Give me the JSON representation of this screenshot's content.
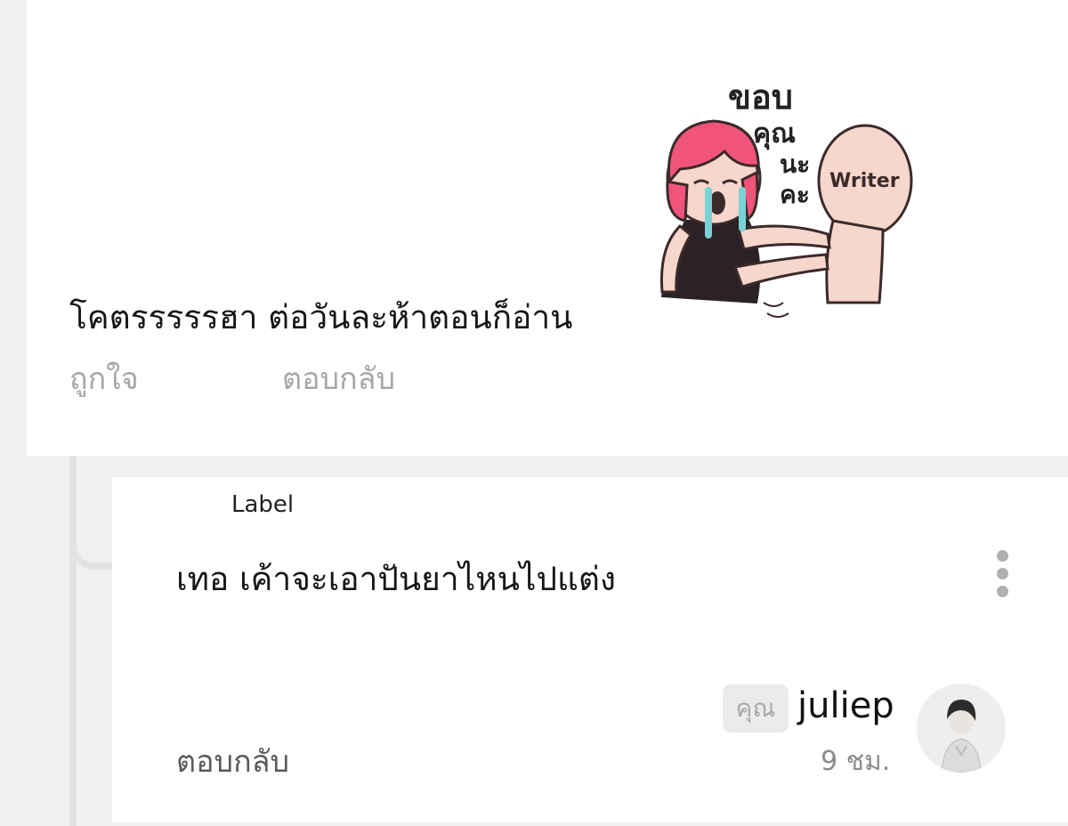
{
  "top_comment": {
    "sticker": {
      "caption": "ขอบ คุณ นะ คะ",
      "tag_text": "Writer"
    },
    "text": "โคตรรรรรฮา ต่อวันละห้าตอนก็อ่าน",
    "like_label": "ถูกใจ",
    "reply_label": "ตอบกลับ"
  },
  "reply": {
    "label": "Label",
    "text": "เทอ เค้าจะเอาปันยาไหนไปแต่ง",
    "badge": "คุณ",
    "username": "juliep",
    "time": "9 ชม.",
    "reply_label": "ตอบกลับ"
  },
  "colors": {
    "background": "#f1f1f1",
    "card": "#ffffff",
    "muted_action": "#a7a7a7",
    "sticker_hair": "#f0547a",
    "sticker_skin": "#f7d6cc",
    "sticker_tears": "#79d3d6"
  },
  "icons": {
    "more": "more-vertical-icon"
  }
}
